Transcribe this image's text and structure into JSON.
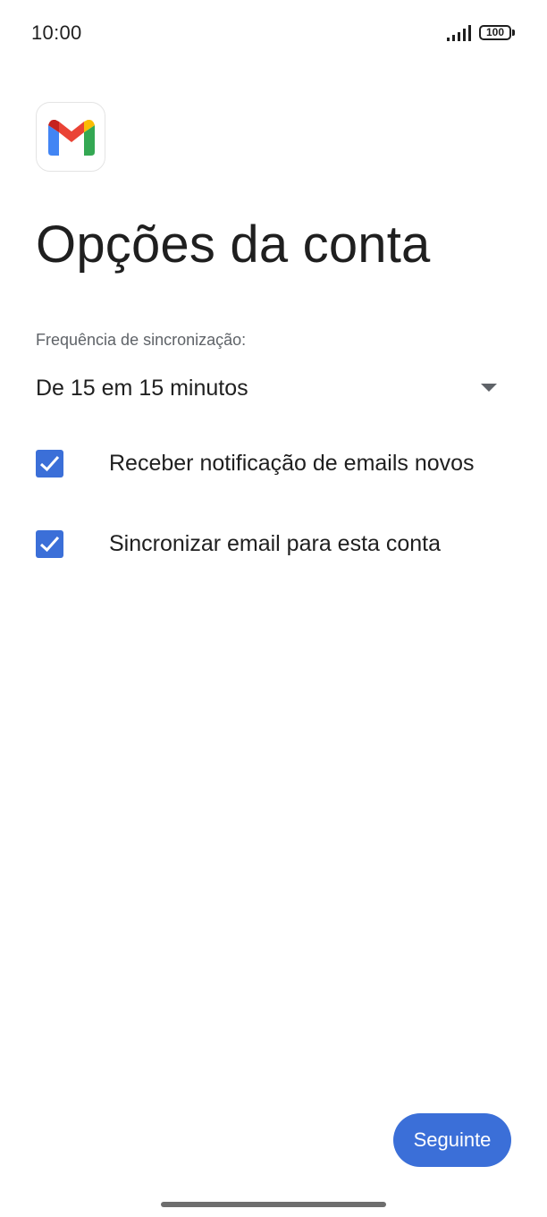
{
  "status_bar": {
    "time": "10:00",
    "battery": "100"
  },
  "app": {
    "logo_icon": "gmail-logo-icon"
  },
  "page": {
    "title": "Opções da conta"
  },
  "sync": {
    "label": "Frequência de sincronização:",
    "selected_value": "De 15 em 15 minutos"
  },
  "options": [
    {
      "label": "Receber notificação de emails novos",
      "checked": true
    },
    {
      "label": "Sincronizar email para esta conta",
      "checked": true
    }
  ],
  "footer": {
    "next_label": "Seguinte"
  },
  "colors": {
    "accent": "#3b6fd8",
    "text": "#1f1f1f",
    "secondary_text": "#5f6368"
  }
}
